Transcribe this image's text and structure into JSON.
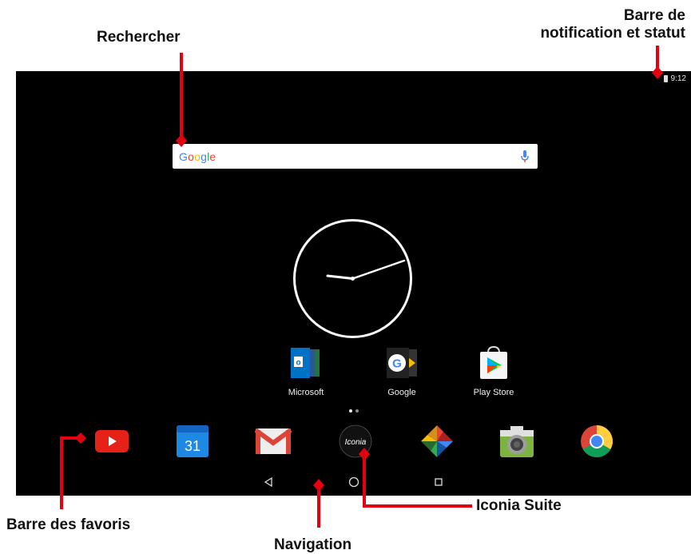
{
  "callouts": {
    "search": "Rechercher",
    "status_line1": "Barre de",
    "status_line2": "notification et statut",
    "favorites": "Barre des favoris",
    "navigation": "Navigation",
    "iconia_suite": "Iconia Suite"
  },
  "status_bar": {
    "time": "9:12",
    "icons": [
      "battery-icon"
    ]
  },
  "search": {
    "logo_text": "Google",
    "icons": [
      "mic-icon"
    ]
  },
  "clock": {
    "type": "analog",
    "icon": "clock-widget"
  },
  "apps": [
    {
      "label": "Microsoft",
      "icon": "microsoft-folder-icon"
    },
    {
      "label": "Google",
      "icon": "google-folder-icon"
    },
    {
      "label": "Play Store",
      "icon": "play-store-icon"
    }
  ],
  "dock": {
    "icons": [
      "youtube-icon",
      "calendar-icon",
      "gmail-icon",
      "iconia-icon",
      "photos-icon",
      "camera-icon",
      "chrome-icon"
    ],
    "calendar_day": "31",
    "iconia_label": "Iconia"
  },
  "navigation": {
    "icons": [
      "back-icon",
      "home-icon",
      "recents-icon"
    ]
  },
  "page_indicator": {
    "pages": 2,
    "current": 1
  },
  "colors": {
    "accent_red": "#e4000f",
    "screen_bg": "#000000"
  }
}
